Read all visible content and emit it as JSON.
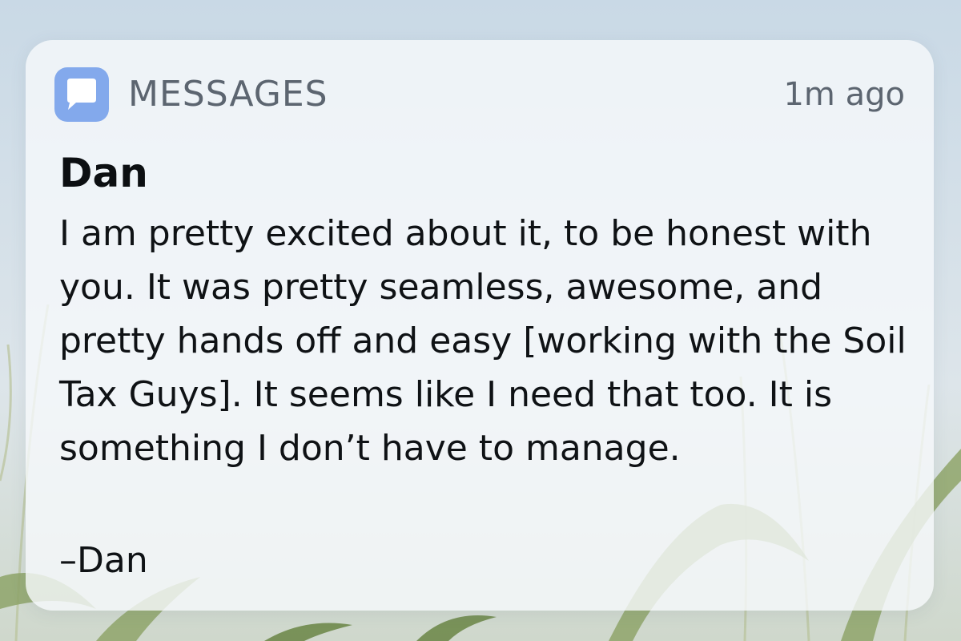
{
  "notification": {
    "app_icon": "messages-bubble-icon",
    "app_name": "MESSAGES",
    "timestamp": "1m ago",
    "sender": "Dan",
    "message": "I am pretty excited about it, to be honest with you. It was pretty seamless, awesome, and pretty hands off and easy [working with the Soil Tax Guys]. It seems like I need that too. It is something I don’t have to manage.",
    "signature": "–Dan"
  },
  "colors": {
    "app_icon_bg": "#83a9ec",
    "card_bg": "#f6f9fb",
    "muted_text": "#5c6570",
    "primary_text": "#0f1215"
  }
}
